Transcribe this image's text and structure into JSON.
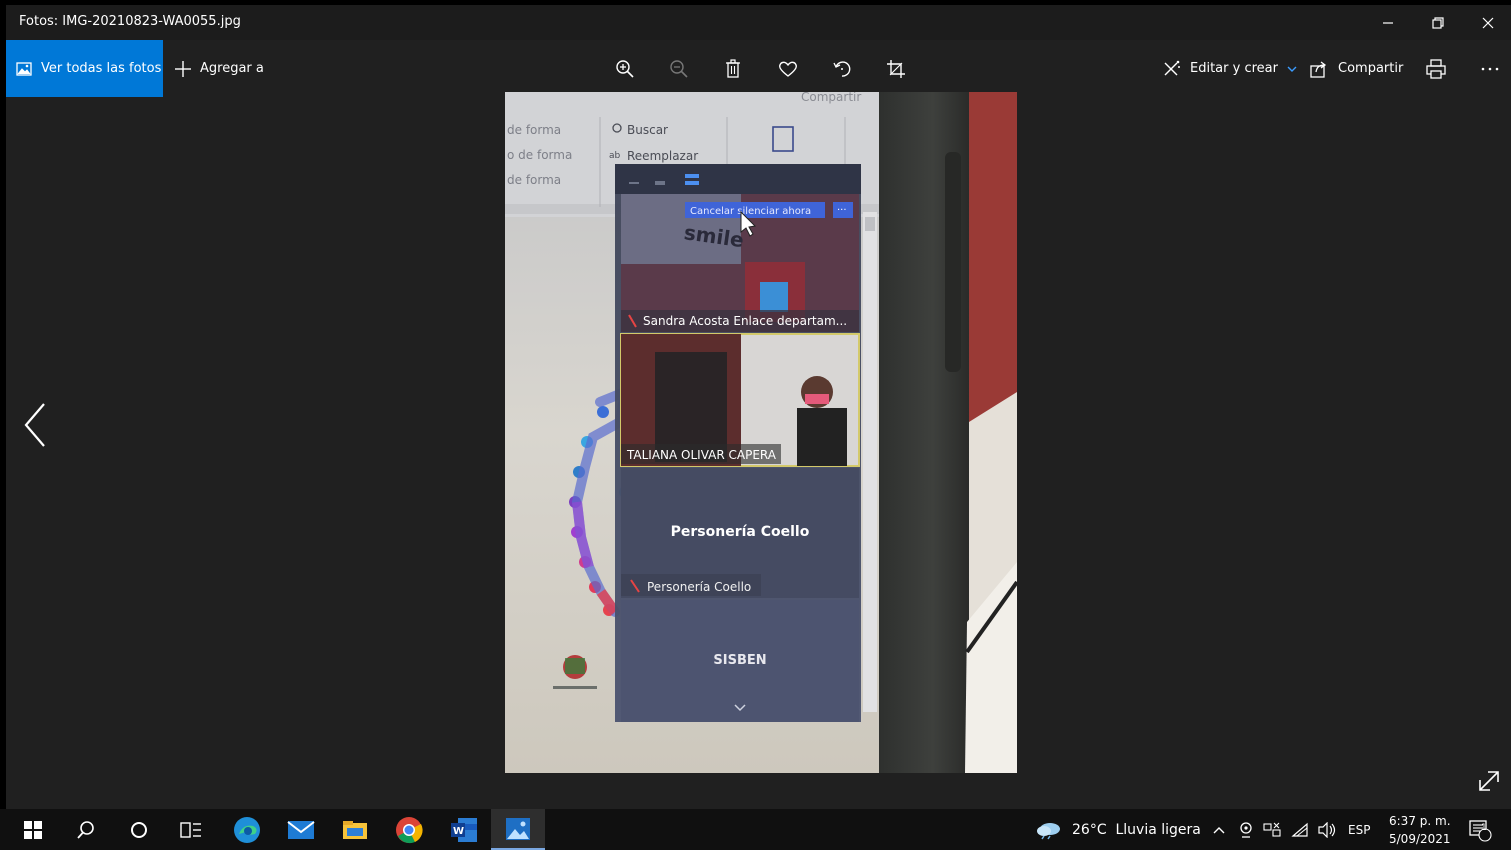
{
  "window": {
    "title": "Fotos: IMG-20210823-WA0055.jpg"
  },
  "toolbar": {
    "all_photos": "Ver todas las fotos",
    "add_to": "Agregar a",
    "edit_create": "Editar y crear",
    "share": "Compartir"
  },
  "photo": {
    "ribbon_share": "Compartir",
    "ribbon_search": "Buscar",
    "ribbon_replace": "Reemplazar",
    "ribbon_left_1": "de forma",
    "ribbon_left_2": "o de forma",
    "ribbon_left_3": "de forma",
    "cancel_btn": "Cancelar silenciar ahora",
    "p1_name": "Sandra Acosta Enlace departam...",
    "p2_name": "TALIANA OLIVAR CAPERA",
    "p3_title": "Personería Coello",
    "p3_name": "Personería Coello",
    "p4_title": "SISBEN",
    "logo_text": "smile"
  },
  "taskbar": {
    "weather": "26°C  Lluvia ligera",
    "lang": "ESP",
    "time": "6:37 p. m.",
    "date": "5/09/2021",
    "notif_count": "1"
  },
  "colors": {
    "accent": "#0078d7",
    "bg": "#202020",
    "titlebar": "#1c1c1c",
    "taskbar": "#101010"
  }
}
